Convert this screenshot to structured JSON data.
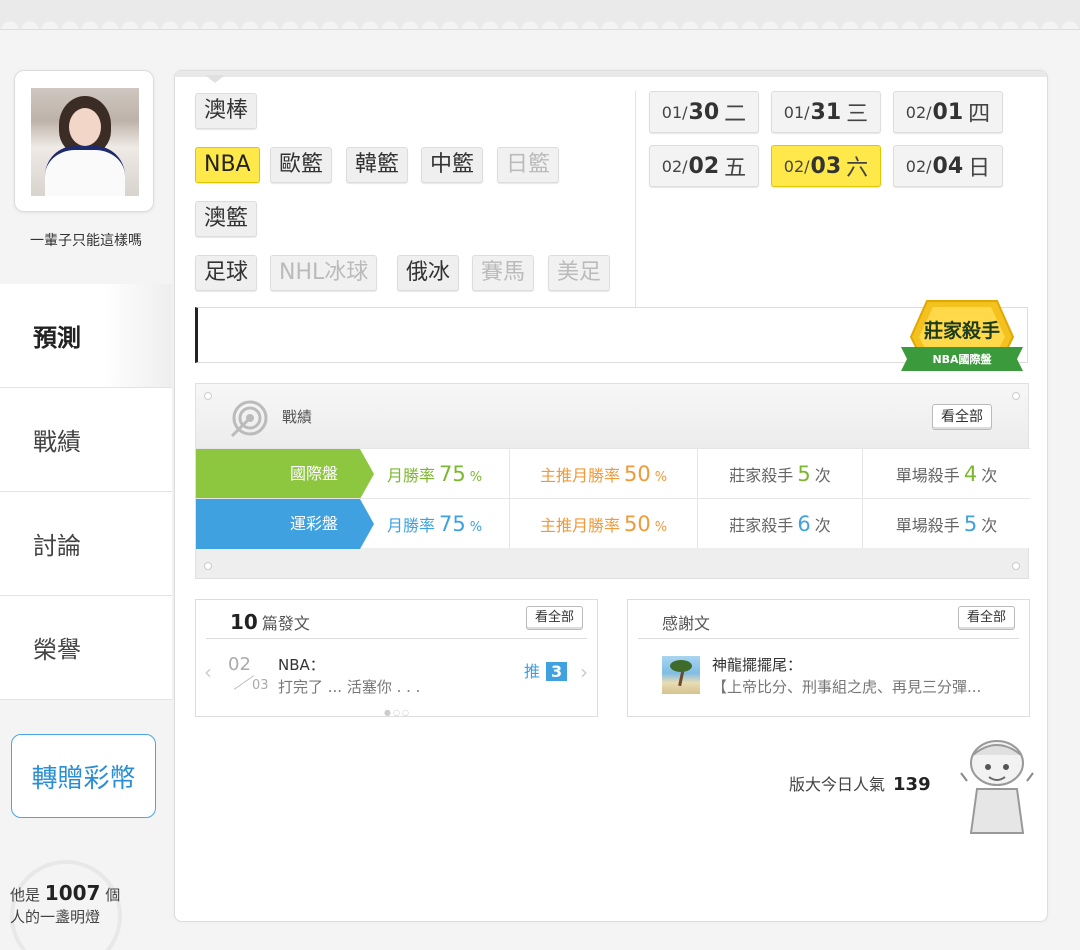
{
  "user": {
    "name": "一輩子只能這樣嗎"
  },
  "nav": {
    "items": [
      {
        "label": "預測",
        "active": true
      },
      {
        "label": "戰績",
        "active": false
      },
      {
        "label": "討論",
        "active": false
      },
      {
        "label": "榮譽",
        "active": false
      }
    ],
    "gift_label": "轉贈彩幣"
  },
  "lamp": {
    "prefix": "他是",
    "count": "1007",
    "suffix": "個",
    "line2": "人的一盞明燈"
  },
  "sports": {
    "row1": [
      "澳棒"
    ],
    "row2": [
      "NBA",
      "歐籃",
      "韓籃",
      "中籃",
      "日籃"
    ],
    "row3": [
      "澳籃"
    ],
    "row4": [
      "足球",
      "NHL冰球",
      "俄冰",
      "賽馬",
      "美足"
    ],
    "active": "NBA",
    "disabled": [
      "日籃",
      "NHL冰球",
      "賽馬",
      "美足"
    ]
  },
  "dates": [
    {
      "month": "01/",
      "day": "30",
      "weekday": "二",
      "active": false
    },
    {
      "month": "01/",
      "day": "31",
      "weekday": "三",
      "active": false
    },
    {
      "month": "02/",
      "day": "01",
      "weekday": "四",
      "active": false
    },
    {
      "month": "02/",
      "day": "02",
      "weekday": "五",
      "active": false
    },
    {
      "month": "02/",
      "day": "03",
      "weekday": "六",
      "active": true
    },
    {
      "month": "02/",
      "day": "04",
      "weekday": "日",
      "active": false
    }
  ],
  "badge": {
    "title": "莊家殺手",
    "subtitle": "NBA國際盤"
  },
  "record": {
    "title": "戰績",
    "view_all": "看全部",
    "rows": [
      {
        "label": "國際盤",
        "color": "#8dc63f",
        "month_rate_label": "月勝率",
        "month_rate": "75",
        "pct": "%",
        "main_rate_label": "主推月勝率",
        "main_rate": "50",
        "killer_label": "莊家殺手",
        "killer": "5",
        "unit": "次",
        "single_label": "單場殺手",
        "single": "4"
      },
      {
        "label": "運彩盤",
        "color": "#3fa1e0",
        "month_rate_label": "月勝率",
        "month_rate": "75",
        "pct": "%",
        "main_rate_label": "主推月勝率",
        "main_rate": "50",
        "killer_label": "莊家殺手",
        "killer": "6",
        "unit": "次",
        "single_label": "單場殺手",
        "single": "5"
      }
    ]
  },
  "posts": {
    "count": "10",
    "title_suffix": "篇發文",
    "view_all": "看全部",
    "item": {
      "date_top": "02",
      "date_bottom": "03",
      "category": "NBA：",
      "text": "打完了 ... 活塞你 . . .",
      "push_label": "推",
      "push_count": "3"
    }
  },
  "thanks": {
    "title": "感謝文",
    "view_all": "看全部",
    "item": {
      "author": "神龍擺擺尾：",
      "text": "【上帝比分、刑事組之虎、再見三分彈..."
    }
  },
  "popularity": {
    "label": "版大今日人氣",
    "value": "139"
  },
  "colors": {
    "accent_yellow": "#ffe94a",
    "green": "#8dc63f",
    "blue": "#3fa1e0",
    "orange": "#f09a3a"
  }
}
